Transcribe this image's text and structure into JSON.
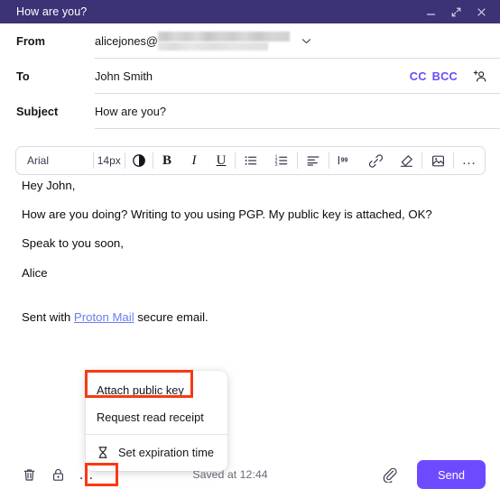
{
  "window": {
    "title": "How are you?",
    "minimize_icon": "minimize-icon",
    "maximize_icon": "expand-icon",
    "close_icon": "close-icon",
    "titlebar_color": "#3c3276"
  },
  "compose": {
    "from": {
      "label": "From",
      "value": "alicejones@",
      "redacted": true,
      "chevron_icon": "chevron-down-icon"
    },
    "to": {
      "label": "To",
      "value": "John Smith",
      "cc_label": "CC",
      "bcc_label": "BCC",
      "add_contact_icon": "add-contact-icon"
    },
    "subject": {
      "label": "Subject",
      "value": "How are you?"
    }
  },
  "toolbar": {
    "font_family": "Arial",
    "font_size": "14px",
    "buttons": [
      {
        "name": "text-color-icon",
        "glyph": "contrast-circle"
      },
      {
        "name": "bold-button",
        "glyph": "B"
      },
      {
        "name": "italic-button",
        "glyph": "I"
      },
      {
        "name": "underline-button",
        "glyph": "U"
      },
      {
        "name": "bullet-list-button",
        "glyph": "bullet-list"
      },
      {
        "name": "numbered-list-button",
        "glyph": "numbered-list"
      },
      {
        "name": "align-button",
        "glyph": "align-left"
      },
      {
        "name": "blockquote-button",
        "glyph": "99"
      },
      {
        "name": "insert-link-button",
        "glyph": "link"
      },
      {
        "name": "clear-formatting-button",
        "glyph": "eraser"
      },
      {
        "name": "insert-image-button",
        "glyph": "image"
      },
      {
        "name": "more-options-button",
        "glyph": "…"
      }
    ]
  },
  "body": {
    "paragraphs": [
      "Hey John,",
      "How are you doing? Writing to you using PGP. My public key is attached, OK?",
      "Speak to you soon,",
      "Alice"
    ],
    "signature": {
      "prefix": "Sent with ",
      "link_text": "Proton Mail",
      "suffix": " secure email.",
      "link_color": "#6a7ef0"
    }
  },
  "menu": {
    "items": [
      {
        "label": "Attach public key",
        "icon": null,
        "highlighted": true
      },
      {
        "label": "Request read receipt",
        "icon": null,
        "highlighted": false
      },
      {
        "label": "Set expiration time",
        "icon": "hourglass-icon",
        "highlighted": false
      }
    ]
  },
  "bottom_bar": {
    "delete_icon": "trash-icon",
    "encryption_icon": "lock-icon",
    "more_label": "…",
    "saved_text": "Saved at 12:44",
    "attachment_icon": "paperclip-icon",
    "send_label": "Send",
    "send_color": "#6d4aff"
  },
  "annotations": {
    "highlight_color": "#f93a11"
  }
}
